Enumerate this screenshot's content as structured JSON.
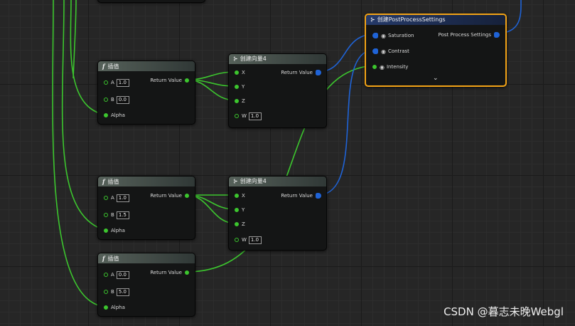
{
  "lerp_title": "插值",
  "lerp_func_icon": "f",
  "lerp_nodes": [
    {
      "a_label": "A",
      "a_value": "1.0",
      "b_label": "B",
      "b_value": "0.0",
      "alpha_label": "Alpha",
      "return_label": "Return Value"
    },
    {
      "a_label": "A",
      "a_value": "1.0",
      "b_label": "B",
      "b_value": "1.5",
      "alpha_label": "Alpha",
      "return_label": "Return Value"
    },
    {
      "a_label": "A",
      "a_value": "0.0",
      "b_label": "B",
      "b_value": "5.0",
      "alpha_label": "Alpha",
      "return_label": "Return Value"
    }
  ],
  "vector_nodes": [
    {
      "title": "创建向量4",
      "x": "X",
      "y": "Y",
      "z": "Z",
      "w": "W",
      "w_value": "1.0",
      "return_label": "Return Value"
    },
    {
      "title": "创建向量4",
      "x": "X",
      "y": "Y",
      "z": "Z",
      "w": "W",
      "w_value": "1.0",
      "return_label": "Return Value"
    }
  ],
  "pps_node": {
    "title": "创建PostProcessSettings",
    "saturation": "Saturation",
    "contrast": "Contrast",
    "intensity": "Intensity",
    "output": "Post Process Settings"
  },
  "watermark": "CSDN @暮志未晚Webgl",
  "colors": {
    "float_wire": "#3cc62e",
    "struct_wire": "#1f63d6",
    "selection": "#f2a316"
  }
}
